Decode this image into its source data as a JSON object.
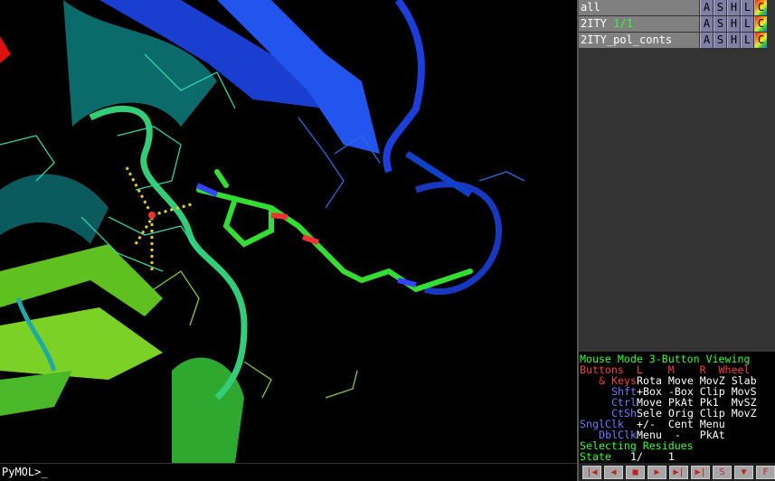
{
  "objects": [
    {
      "name": "all",
      "frame": ""
    },
    {
      "name": "2ITY",
      "frame": "1/1"
    },
    {
      "name": "2ITY_pol_conts",
      "frame": ""
    }
  ],
  "object_buttons": [
    "A",
    "S",
    "H",
    "L",
    "C"
  ],
  "mouse_panel": {
    "title": "Mouse Mode 3-Button Viewing",
    "header": "Buttons  L    M    R  Wheel",
    "rows": [
      {
        "key": "& Keys",
        "text": "Rota Move MovZ Slab"
      },
      {
        "key": "Shft",
        "text": "+Box -Box Clip MovS"
      },
      {
        "key": "Ctrl",
        "text": "Move PkAt Pk1  MvSZ"
      },
      {
        "key": "CtSh",
        "text": "Sele Orig Clip MovZ"
      },
      {
        "key": "SnglClk",
        "text": "+/-  Cent Menu"
      },
      {
        "key": "DblClk",
        "text": "Menu  -   PkAt"
      }
    ],
    "selecting": "Selecting Residues",
    "state_label": "State",
    "state_value": "1/    1"
  },
  "command_prompt": "PyMOL>_",
  "movie_controls": [
    "|◀",
    "◀",
    "■",
    "▶",
    "▶|",
    "▶|",
    "S",
    "▼",
    "F"
  ]
}
